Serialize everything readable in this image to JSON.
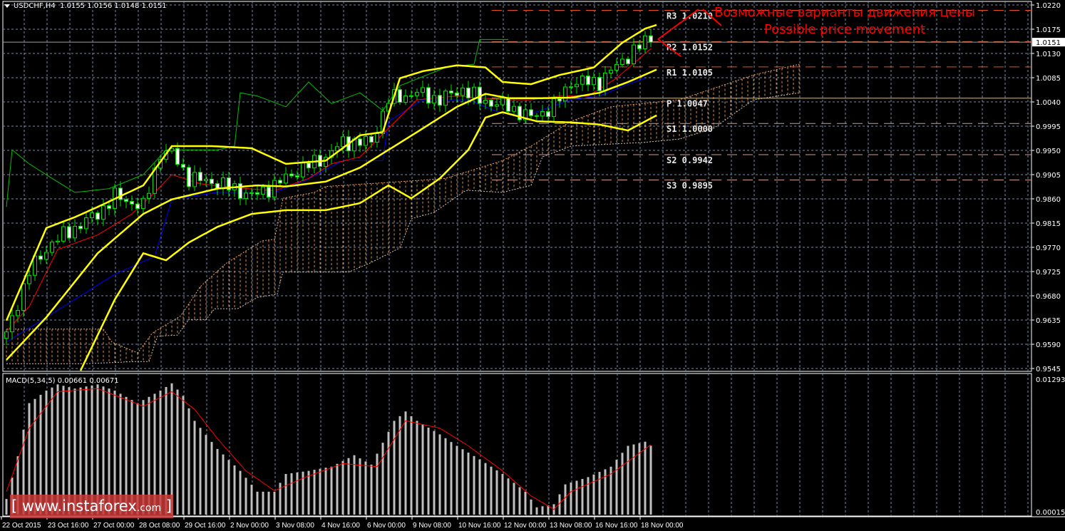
{
  "header": {
    "symbol": "USDCHF,H4",
    "ohlc": "1.0155 1.0156 1.0148 1.0151"
  },
  "macd_label": "MACD(5,34,5) 0.00661 0.00671",
  "annotation": {
    "line1": "Возможные варианты движения цены",
    "line2": "Possible price movement",
    "color": "#ff0000"
  },
  "watermark": {
    "open": "[",
    "main": "www.instaforex",
    "suffix": ".com",
    "close": "]"
  },
  "current_price": "1.0151",
  "colors": {
    "background": "#000000",
    "grid": "#7d8aa0",
    "candle": "#00e000",
    "bb": "#ffff00",
    "tenkan": "#ff0000",
    "kijun": "#0000ff",
    "chikou": "#00c000",
    "spanA": "#f4a460",
    "spanB": "#d8c0b8",
    "resistance": "#e8501e",
    "pivot": "#ffc000",
    "support": "#d09a90",
    "macd_hist": "#c0c0c0",
    "macd_signal": "#ff0000"
  },
  "chart_data": {
    "type": "candlestick",
    "title": "USDCHF,H4",
    "ylim": [
      0.9545,
      1.022
    ],
    "y_ticks": [
      "1.0220",
      "1.0175",
      "1.0130",
      "1.0085",
      "1.0040",
      "0.9995",
      "0.9950",
      "0.9905",
      "0.9860",
      "0.9815",
      "0.9770",
      "0.9725",
      "0.9680",
      "0.9635",
      "0.9590",
      "0.9545"
    ],
    "x_ticks": [
      "22 Oct 2015",
      "23 Oct 16:00",
      "27 Oct 00:00",
      "28 Oct 08:00",
      "29 Oct 16:00",
      "2 Nov 00:00",
      "3 Nov 08:00",
      "4 Nov 16:00",
      "6 Nov 00:00",
      "9 Nov 08:00",
      "10 Nov 16:00",
      "12 Nov 00:00",
      "13 Nov 08:00",
      "16 Nov 16:00",
      "18 Nov 00:00"
    ],
    "bars": 114,
    "close": [
      [
        0,
        0.9607
      ],
      [
        4,
        0.9726
      ],
      [
        8,
        0.9779
      ],
      [
        12,
        0.9806
      ],
      [
        16,
        0.9832
      ],
      [
        19,
        0.9865
      ],
      [
        24,
        0.9845
      ],
      [
        27,
        0.9945
      ],
      [
        29,
        0.9945
      ],
      [
        32,
        0.9898
      ],
      [
        36,
        0.9892
      ],
      [
        40,
        0.9879
      ],
      [
        43,
        0.9865
      ],
      [
        47,
        0.9885
      ],
      [
        51,
        0.9912
      ],
      [
        56,
        0.9938
      ],
      [
        59,
        0.9965
      ],
      [
        64,
        0.9965
      ],
      [
        67,
        1.0044
      ],
      [
        72,
        1.0057
      ],
      [
        76,
        1.0044
      ],
      [
        80,
        1.0064
      ],
      [
        83,
        1.0044
      ],
      [
        88,
        1.0031
      ],
      [
        92,
        1.0011
      ],
      [
        96,
        1.0031
      ],
      [
        99,
        1.0077
      ],
      [
        104,
        1.0077
      ],
      [
        108,
        1.0117
      ],
      [
        112,
        1.0152
      ],
      [
        113,
        1.0151
      ]
    ],
    "bb_upper": [
      [
        0,
        0.9634
      ],
      [
        7,
        0.9806
      ],
      [
        12,
        0.9826
      ],
      [
        16,
        0.9845
      ],
      [
        24,
        0.9885
      ],
      [
        29,
        0.9958
      ],
      [
        36,
        0.9958
      ],
      [
        43,
        0.9954
      ],
      [
        49,
        0.9925
      ],
      [
        56,
        0.9931
      ],
      [
        62,
        0.9978
      ],
      [
        66,
        0.9984
      ],
      [
        69,
        1.0084
      ],
      [
        73,
        1.0097
      ],
      [
        79,
        1.0108
      ],
      [
        84,
        1.0104
      ],
      [
        87,
        1.0077
      ],
      [
        92,
        1.0073
      ],
      [
        97,
        1.009
      ],
      [
        103,
        1.0104
      ],
      [
        108,
        1.015
      ],
      [
        112,
        1.0176
      ],
      [
        114,
        1.0183
      ]
    ],
    "bb_middle": [
      [
        0,
        0.9561
      ],
      [
        7,
        0.964
      ],
      [
        16,
        0.9759
      ],
      [
        24,
        0.9832
      ],
      [
        29,
        0.9859
      ],
      [
        37,
        0.9879
      ],
      [
        44,
        0.9885
      ],
      [
        49,
        0.9883
      ],
      [
        56,
        0.9892
      ],
      [
        62,
        0.9918
      ],
      [
        67,
        0.9951
      ],
      [
        72,
        0.9984
      ],
      [
        79,
        1.0031
      ],
      [
        84,
        1.0055
      ],
      [
        88,
        1.0047
      ],
      [
        94,
        1.0047
      ],
      [
        99,
        1.0048
      ],
      [
        104,
        1.0057
      ],
      [
        109,
        1.0077
      ],
      [
        114,
        1.01
      ]
    ],
    "bb_lower": [
      [
        13,
        0.9541
      ],
      [
        19,
        0.9673
      ],
      [
        24,
        0.9759
      ],
      [
        28,
        0.9746
      ],
      [
        32,
        0.9779
      ],
      [
        37,
        0.9808
      ],
      [
        43,
        0.9832
      ],
      [
        49,
        0.9839
      ],
      [
        56,
        0.9839
      ],
      [
        62,
        0.9852
      ],
      [
        67,
        0.9885
      ],
      [
        71,
        0.9861
      ],
      [
        76,
        0.9898
      ],
      [
        81,
        0.9951
      ],
      [
        84,
        1.0011
      ],
      [
        87,
        1.0021
      ],
      [
        93,
        1.0004
      ],
      [
        99,
        1.0002
      ],
      [
        104,
        0.9998
      ],
      [
        109,
        0.9987
      ],
      [
        114,
        1.0015
      ]
    ],
    "tenkan": [
      [
        0,
        0.9614
      ],
      [
        4,
        0.966
      ],
      [
        9,
        0.9766
      ],
      [
        16,
        0.9793
      ],
      [
        22,
        0.9832
      ],
      [
        26,
        0.9872
      ],
      [
        29,
        0.9905
      ],
      [
        34,
        0.9888
      ],
      [
        40,
        0.9881
      ],
      [
        47,
        0.9875
      ],
      [
        53,
        0.9898
      ],
      [
        57,
        0.9925
      ],
      [
        62,
        0.9938
      ],
      [
        67,
        0.9991
      ],
      [
        72,
        1.0044
      ],
      [
        79,
        1.0051
      ],
      [
        87,
        1.0044
      ],
      [
        92,
        1.0044
      ],
      [
        97,
        1.0051
      ],
      [
        102,
        1.0051
      ],
      [
        107,
        1.0084
      ],
      [
        112,
        1.013
      ],
      [
        113,
        1.0139
      ]
    ],
    "kijun": [
      [
        0,
        0.9594
      ],
      [
        7,
        0.964
      ],
      [
        13,
        0.968
      ],
      [
        19,
        0.972
      ],
      [
        26,
        0.9753
      ],
      [
        29,
        0.9859
      ],
      [
        37,
        0.9872
      ],
      [
        47,
        0.9872
      ],
      [
        52,
        0.9892
      ],
      [
        59,
        0.9931
      ],
      [
        66,
        0.9931
      ],
      [
        67,
        1.0004
      ],
      [
        73,
        1.0044
      ],
      [
        81,
        1.0044
      ],
      [
        87,
        1.0018
      ],
      [
        92,
        1.0018
      ],
      [
        99,
        1.0044
      ],
      [
        104,
        1.0051
      ],
      [
        109,
        1.0073
      ],
      [
        112,
        1.0084
      ]
    ],
    "chikou": [
      [
        0,
        0.9845
      ],
      [
        1,
        0.9951
      ],
      [
        4,
        0.9925
      ],
      [
        8,
        0.9898
      ],
      [
        12,
        0.9872
      ],
      [
        18,
        0.9879
      ],
      [
        24,
        0.9905
      ],
      [
        28,
        0.9951
      ],
      [
        37,
        0.9951
      ],
      [
        40,
        0.9958
      ],
      [
        41,
        1.0057
      ],
      [
        44,
        1.0051
      ],
      [
        49,
        1.0031
      ],
      [
        53,
        1.0077
      ],
      [
        57,
        1.0037
      ],
      [
        62,
        1.0057
      ],
      [
        66,
        1.0024
      ],
      [
        69,
        1.007
      ],
      [
        77,
        1.0104
      ],
      [
        82,
        1.011
      ],
      [
        83,
        1.0156
      ],
      [
        88,
        1.0156
      ]
    ],
    "span_a": [
      [
        0,
        0.9618
      ],
      [
        17,
        0.9618
      ],
      [
        18.5,
        0.9594
      ],
      [
        23,
        0.9574
      ],
      [
        25.6,
        0.9611
      ],
      [
        30.6,
        0.9643
      ],
      [
        34,
        0.9697
      ],
      [
        38.5,
        0.974
      ],
      [
        44.8,
        0.9782
      ],
      [
        47,
        0.9785
      ],
      [
        48.5,
        0.9861
      ],
      [
        54,
        0.9872
      ],
      [
        56,
        0.9883
      ],
      [
        72,
        0.9894
      ],
      [
        77,
        0.9898
      ],
      [
        87,
        0.9931
      ],
      [
        92,
        0.9958
      ],
      [
        99,
        1.0004
      ],
      [
        106,
        1.0031
      ],
      [
        118,
        1.0044
      ],
      [
        131,
        1.009
      ],
      [
        139,
        1.011
      ]
    ],
    "span_b": [
      [
        0,
        0.9554
      ],
      [
        14,
        0.9554
      ],
      [
        23,
        0.9558
      ],
      [
        25,
        0.9558
      ],
      [
        26.5,
        0.9605
      ],
      [
        30,
        0.9607
      ],
      [
        32,
        0.9636
      ],
      [
        35,
        0.9636
      ],
      [
        36.5,
        0.9656
      ],
      [
        40.6,
        0.9656
      ],
      [
        44,
        0.9677
      ],
      [
        47.5,
        0.9683
      ],
      [
        48.4,
        0.9724
      ],
      [
        60,
        0.9724
      ],
      [
        64,
        0.9742
      ],
      [
        69,
        0.9769
      ],
      [
        71,
        0.9823
      ],
      [
        75,
        0.9835
      ],
      [
        80.6,
        0.9876
      ],
      [
        87,
        0.9872
      ],
      [
        92,
        0.9885
      ],
      [
        94,
        0.9938
      ],
      [
        99,
        0.9958
      ],
      [
        112,
        0.9965
      ],
      [
        118,
        0.9971
      ],
      [
        124,
        0.9991
      ],
      [
        131,
        1.0044
      ],
      [
        139,
        1.0057
      ]
    ],
    "pivots": [
      {
        "label": "R3 1.0210",
        "value": 1.021,
        "kind": "resistance"
      },
      {
        "label": "R2 1.0152",
        "value": 1.0152,
        "kind": "resistance"
      },
      {
        "label": "R1 1.0105",
        "value": 1.0105,
        "kind": "resistance"
      },
      {
        "label": "P 1.0047",
        "value": 1.0047,
        "kind": "pivot"
      },
      {
        "label": "S1 1.0000",
        "value": 1.0,
        "kind": "support"
      },
      {
        "label": "S2 0.9942",
        "value": 0.9942,
        "kind": "support"
      },
      {
        "label": "S3 0.9895",
        "value": 0.9895,
        "kind": "support"
      }
    ],
    "macd": {
      "label": "MACD(5,34,5)",
      "ylim": [
        0,
        0.01293
      ],
      "y_ticks": [
        "0.01293",
        "0.00015"
      ],
      "histogram": [
        [
          0,
          0.0015
        ],
        [
          2,
          0.0056
        ],
        [
          4,
          0.0107
        ],
        [
          7,
          0.0119
        ],
        [
          9,
          0.0125
        ],
        [
          12,
          0.0121
        ],
        [
          16,
          0.0125
        ],
        [
          19,
          0.0119
        ],
        [
          23,
          0.0107
        ],
        [
          27,
          0.0119
        ],
        [
          29,
          0.0126
        ],
        [
          31,
          0.0114
        ],
        [
          33,
          0.009
        ],
        [
          37,
          0.0063
        ],
        [
          41,
          0.0042
        ],
        [
          44,
          0.0022
        ],
        [
          47,
          0.0022
        ],
        [
          49,
          0.0039
        ],
        [
          53,
          0.0042
        ],
        [
          57,
          0.0046
        ],
        [
          61,
          0.0057
        ],
        [
          64,
          0.0048
        ],
        [
          68,
          0.009
        ],
        [
          70,
          0.0099
        ],
        [
          72,
          0.009
        ],
        [
          76,
          0.0077
        ],
        [
          79,
          0.0066
        ],
        [
          83,
          0.0053
        ],
        [
          87,
          0.0039
        ],
        [
          91,
          0.0022
        ],
        [
          93,
          0.0007
        ],
        [
          96,
          0.001
        ],
        [
          98,
          0.0029
        ],
        [
          102,
          0.0036
        ],
        [
          106,
          0.0046
        ],
        [
          109,
          0.0066
        ],
        [
          112,
          0.007
        ],
        [
          113,
          0.00661
        ]
      ],
      "signal": [
        [
          0,
          0.0022
        ],
        [
          4,
          0.0083
        ],
        [
          9,
          0.0118
        ],
        [
          16,
          0.0121
        ],
        [
          24,
          0.0104
        ],
        [
          29,
          0.0118
        ],
        [
          33,
          0.0101
        ],
        [
          37,
          0.0073
        ],
        [
          42,
          0.0042
        ],
        [
          47,
          0.0023
        ],
        [
          52,
          0.0035
        ],
        [
          59,
          0.0049
        ],
        [
          65,
          0.0046
        ],
        [
          70,
          0.009
        ],
        [
          76,
          0.0083
        ],
        [
          81,
          0.0066
        ],
        [
          87,
          0.0042
        ],
        [
          92,
          0.0018
        ],
        [
          96,
          0.0005
        ],
        [
          99,
          0.0022
        ],
        [
          106,
          0.0039
        ],
        [
          113,
          0.00671
        ]
      ]
    }
  }
}
